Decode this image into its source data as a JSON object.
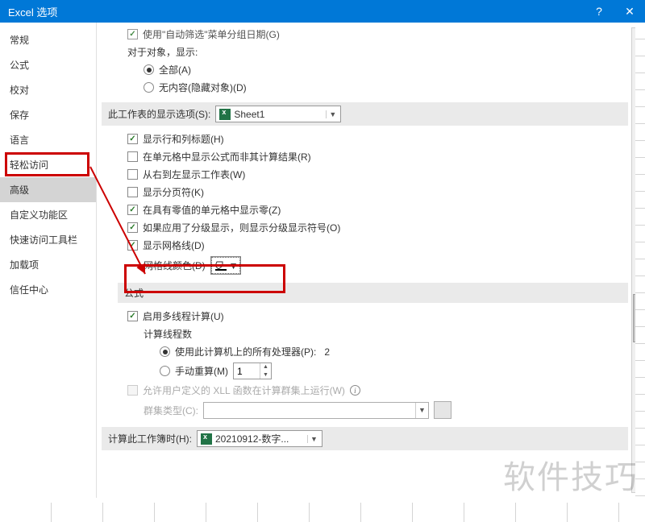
{
  "titlebar": {
    "title": "Excel 选项",
    "help": "?",
    "close": "✕"
  },
  "sidebar": {
    "items": [
      {
        "label": "常规"
      },
      {
        "label": "公式"
      },
      {
        "label": "校对"
      },
      {
        "label": "保存"
      },
      {
        "label": "语言"
      },
      {
        "label": "轻松访问"
      },
      {
        "label": "高级"
      },
      {
        "label": "自定义功能区"
      },
      {
        "label": "快速访问工具栏"
      },
      {
        "label": "加载项"
      },
      {
        "label": "信任中心"
      }
    ]
  },
  "top": {
    "c1": "使用\"自动筛选\"菜单分组日期(G)",
    "heading": "对于对象，显示:",
    "r1": "全部(A)",
    "r2": "无内容(隐藏对象)(D)"
  },
  "sheet_opts": {
    "hdr": "此工作表的显示选项(S):",
    "sheet": "Sheet1",
    "c1": "显示行和列标题(H)",
    "c2": "在单元格中显示公式而非其计算结果(R)",
    "c3": "从右到左显示工作表(W)",
    "c4": "显示分页符(K)",
    "c5": "在具有零值的单元格中显示零(Z)",
    "c6": "如果应用了分级显示，则显示分级显示符号(O)",
    "c7": "显示网格线(D)",
    "grid_color_lbl": "网格线颜色(D)"
  },
  "formula": {
    "hdr": "公式",
    "c1": "启用多线程计算(U)",
    "sub_hdr": "计算线程数",
    "r1": "使用此计算机上的所有处理器(P):",
    "proc_count": "2",
    "r2": "手动重算(M)",
    "spinner_val": "1",
    "c2": "允许用户定义的 XLL 函数在计算群集上运行(W)",
    "cluster_lbl": "群集类型(C):"
  },
  "calc_wb": {
    "hdr": "计算此工作簿时(H):",
    "wb": "20210912-数字..."
  },
  "watermark": "软件技巧"
}
